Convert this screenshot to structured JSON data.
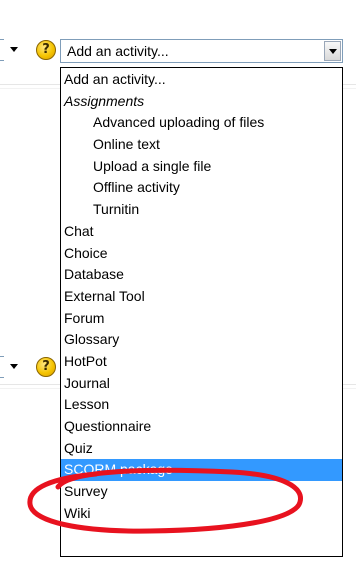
{
  "colors": {
    "selection_bg": "#3399ff",
    "selection_fg": "#ffffff",
    "annotation": "#e8121f",
    "help_icon": "#f5c400"
  },
  "select": {
    "value": "Add an activity...",
    "button_icon": "chevron-down-icon"
  },
  "help_icon_glyph": "?",
  "dropdown": {
    "items": [
      {
        "label": "Add an activity...",
        "kind": "option"
      },
      {
        "label": "Assignments",
        "kind": "group"
      },
      {
        "label": "Advanced uploading of files",
        "kind": "sub"
      },
      {
        "label": "Online text",
        "kind": "sub"
      },
      {
        "label": "Upload a single file",
        "kind": "sub"
      },
      {
        "label": "Offline activity",
        "kind": "sub"
      },
      {
        "label": "Turnitin",
        "kind": "sub"
      },
      {
        "label": "Chat",
        "kind": "option"
      },
      {
        "label": "Choice",
        "kind": "option"
      },
      {
        "label": "Database",
        "kind": "option"
      },
      {
        "label": "External Tool",
        "kind": "option"
      },
      {
        "label": "Forum",
        "kind": "option"
      },
      {
        "label": "Glossary",
        "kind": "option"
      },
      {
        "label": "HotPot",
        "kind": "option"
      },
      {
        "label": "Journal",
        "kind": "option"
      },
      {
        "label": "Lesson",
        "kind": "option"
      },
      {
        "label": "Questionnaire",
        "kind": "option"
      },
      {
        "label": "Quiz",
        "kind": "option"
      },
      {
        "label": "SCORM package",
        "kind": "option",
        "selected": true
      },
      {
        "label": "Survey",
        "kind": "option"
      },
      {
        "label": "Wiki",
        "kind": "option"
      }
    ]
  }
}
